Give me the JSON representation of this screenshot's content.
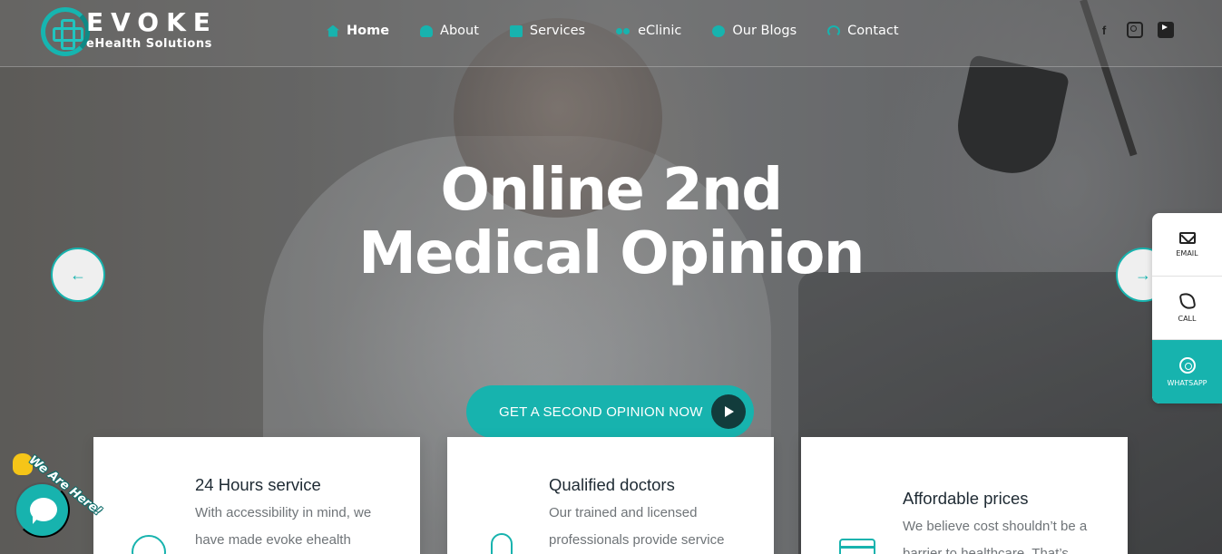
{
  "brand": {
    "name": "EVOKE",
    "tagline": "eHealth Solutions",
    "accent_color": "#17b3ae"
  },
  "nav": {
    "items": [
      {
        "label": "Home",
        "icon": "home-icon",
        "active": true
      },
      {
        "label": "About",
        "icon": "hospital-icon",
        "active": false
      },
      {
        "label": "Services",
        "icon": "store-icon",
        "active": false
      },
      {
        "label": "eClinic",
        "icon": "users-icon",
        "active": false
      },
      {
        "label": "Our Blogs",
        "icon": "globe-icon",
        "active": false
      },
      {
        "label": "Contact",
        "icon": "headset-icon",
        "active": false
      }
    ]
  },
  "social": {
    "facebook": "f",
    "instagram": "instagram-icon",
    "youtube": "youtube-icon"
  },
  "hero": {
    "title_line1": "Online 2nd",
    "title_line2": "Medical Opinion",
    "cta_label": "GET A SECOND OPINION NOW",
    "prev_arrow": "←",
    "next_arrow": "→"
  },
  "contact_widget": {
    "email_label": "EMAIL",
    "call_label": "CALL",
    "whatsapp_label": "WHATSAPP"
  },
  "features": [
    {
      "title": "24 Hours service",
      "text": "With accessibility in mind, we have made evoke ehealth",
      "icon": "clock-icon"
    },
    {
      "title": "Qualified doctors",
      "text": "Our trained and licensed professionals provide service",
      "icon": "doctor-icon"
    },
    {
      "title": "Affordable prices",
      "text": "We believe cost shouldn’t be a barrier to healthcare. That’s",
      "icon": "credit-card-icon"
    }
  ],
  "chat": {
    "label": "We Are Here!"
  }
}
